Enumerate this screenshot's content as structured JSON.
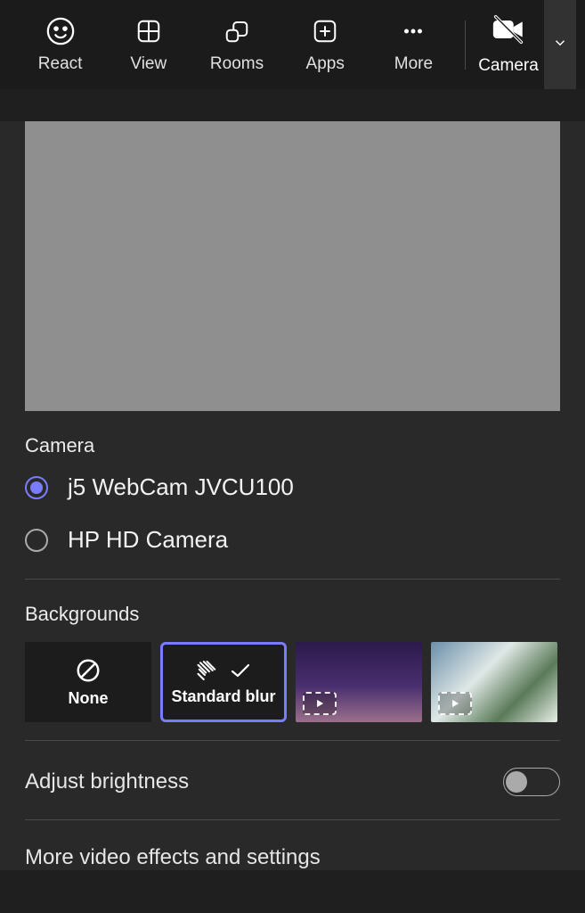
{
  "toolbar": {
    "react": "React",
    "view": "View",
    "rooms": "Rooms",
    "apps": "Apps",
    "more": "More",
    "camera": "Camera"
  },
  "panel": {
    "cameraLabel": "Camera",
    "cameraOptions": [
      {
        "label": "j5 WebCam JVCU100",
        "selected": true
      },
      {
        "label": "HP HD Camera",
        "selected": false
      }
    ],
    "backgroundsLabel": "Backgrounds",
    "bgTiles": {
      "none": "None",
      "standardBlur": "Standard blur"
    },
    "adjustBrightness": "Adjust brightness",
    "brightnessOn": false,
    "moreEffects": "More video effects and settings"
  }
}
